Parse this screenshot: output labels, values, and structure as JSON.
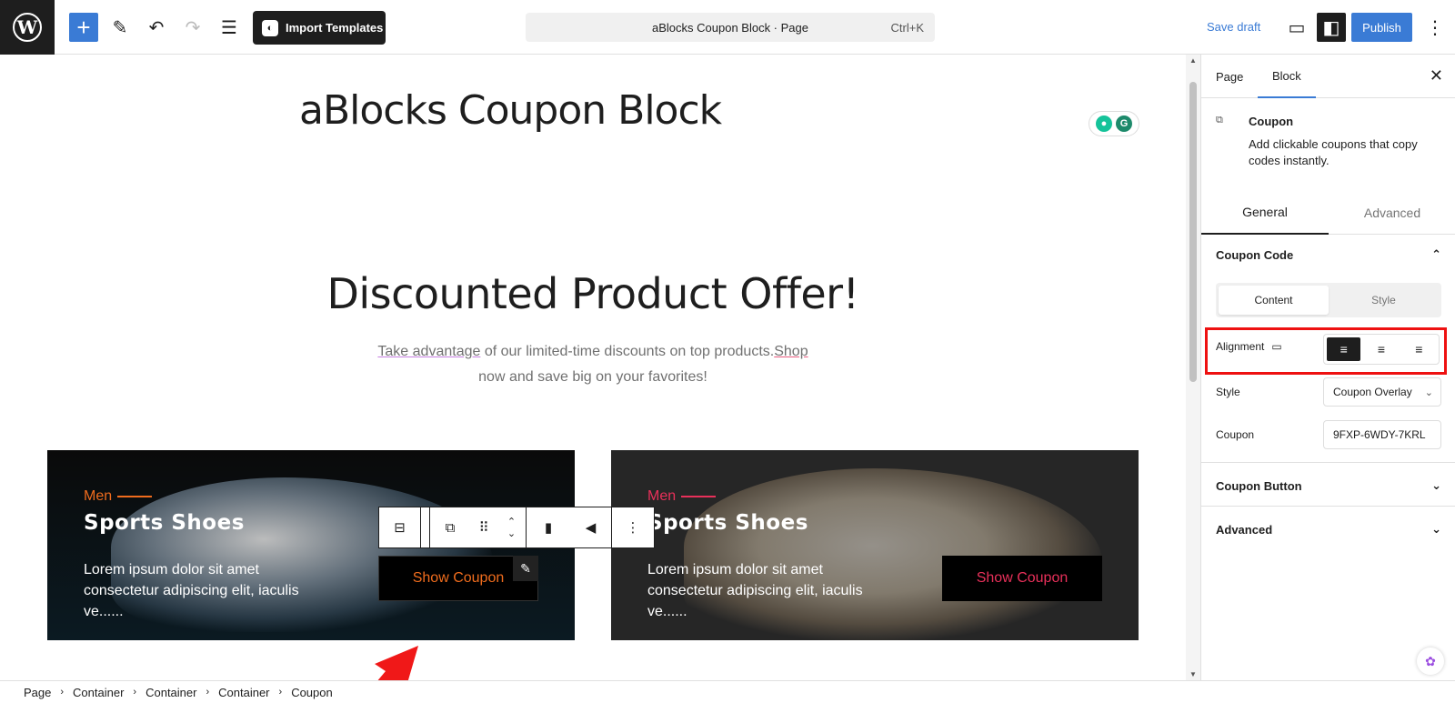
{
  "topbar": {
    "add_icon": "plus-icon",
    "import_templates": "Import Templates",
    "command_bar": "aBlocks Coupon Block · Page",
    "command_shortcut": "Ctrl+K",
    "save_draft": "Save draft",
    "publish": "Publish"
  },
  "editor": {
    "page_title": "aBlocks Coupon Block",
    "heading": "Discounted Product Offer!",
    "subtext_part1": "Take advantage",
    "subtext_part2": " of our limited-time discounts on top products.",
    "subtext_part3": "Shop",
    "subtext_part4": " now and save big on your favorites!",
    "cards": [
      {
        "tag": "Men",
        "title": "Sports Shoes",
        "description": "Lorem ipsum dolor sit amet consectetur adipiscing elit, iaculis ve......",
        "button": "Show Coupon",
        "accent": "#ef6c1d"
      },
      {
        "tag": "Men",
        "title": "Sports Shoes",
        "description": "Lorem ipsum dolor sit amet consectetur adipiscing elit, iaculis ve......",
        "button": "Show Coupon",
        "accent": "#e8305a"
      }
    ]
  },
  "breadcrumb": [
    "Page",
    "Container",
    "Container",
    "Container",
    "Coupon"
  ],
  "sidebar": {
    "tabs": [
      "Page",
      "Block"
    ],
    "active_tab": "Block",
    "block_name": "Coupon",
    "block_description": "Add clickable coupons that copy codes instantly.",
    "settings_tabs": [
      "General",
      "Advanced"
    ],
    "coupon_code_title": "Coupon Code",
    "segment": [
      "Content",
      "Style"
    ],
    "alignment_label": "Alignment",
    "style_label": "Style",
    "style_value": "Coupon Overlay",
    "coupon_label": "Coupon",
    "coupon_value": "9FXP-6WDY-7KRL",
    "coupon_button_title": "Coupon Button",
    "advanced_title": "Advanced"
  },
  "colors": {
    "accent_blue": "#3a7bd5",
    "highlight_red": "#e11111"
  }
}
